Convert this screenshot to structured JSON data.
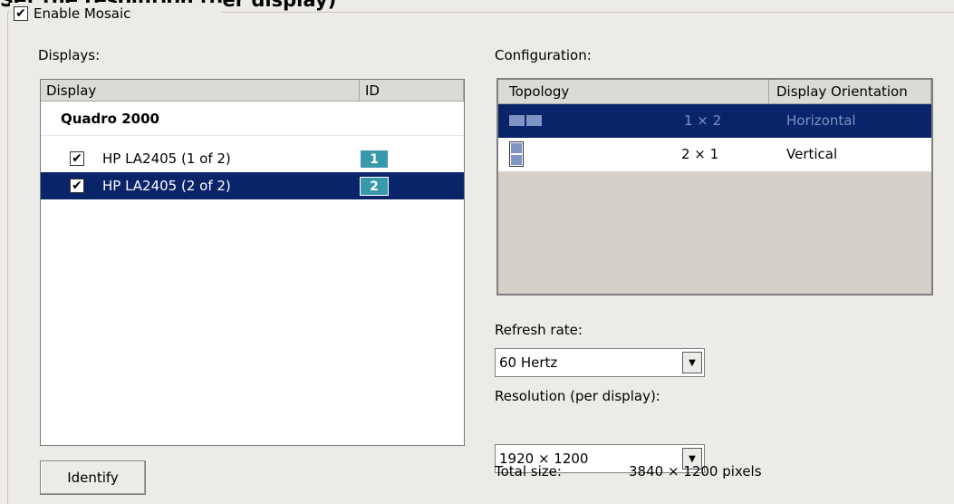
{
  "cut_heading": "Set the resolution (per display)",
  "enable_mosaic": {
    "label": "Enable Mosaic",
    "checked": true
  },
  "displays": {
    "section_label": "Displays:",
    "columns": [
      "Display",
      "ID"
    ],
    "group_name": "Quadro 2000",
    "items": [
      {
        "name": "HP LA2405 (1 of 2)",
        "id": "1",
        "checked": true,
        "selected": false
      },
      {
        "name": "HP LA2405 (2 of 2)",
        "id": "2",
        "checked": true,
        "selected": true
      }
    ]
  },
  "configuration": {
    "section_label": "Configuration:",
    "columns": [
      "Topology",
      "Display Orientation"
    ],
    "rows": [
      {
        "topology": "1 × 2",
        "orientation": "Horizontal",
        "selected": true,
        "icon": "horizontal-topology-icon"
      },
      {
        "topology": "2 × 1",
        "orientation": "Vertical",
        "selected": false,
        "icon": "vertical-topology-icon"
      }
    ]
  },
  "refresh_rate": {
    "label": "Refresh rate:",
    "value": "60 Hertz"
  },
  "resolution": {
    "label": "Resolution (per display):",
    "value": "1920 × 1200"
  },
  "total_size": {
    "label": "Total size:",
    "value": "3840 × 1200 pixels"
  },
  "identify_button": "Identify",
  "colors": {
    "selection": "#0a246a",
    "id_badge": "#3a98ad",
    "panel_bg": "#ecebe7"
  }
}
